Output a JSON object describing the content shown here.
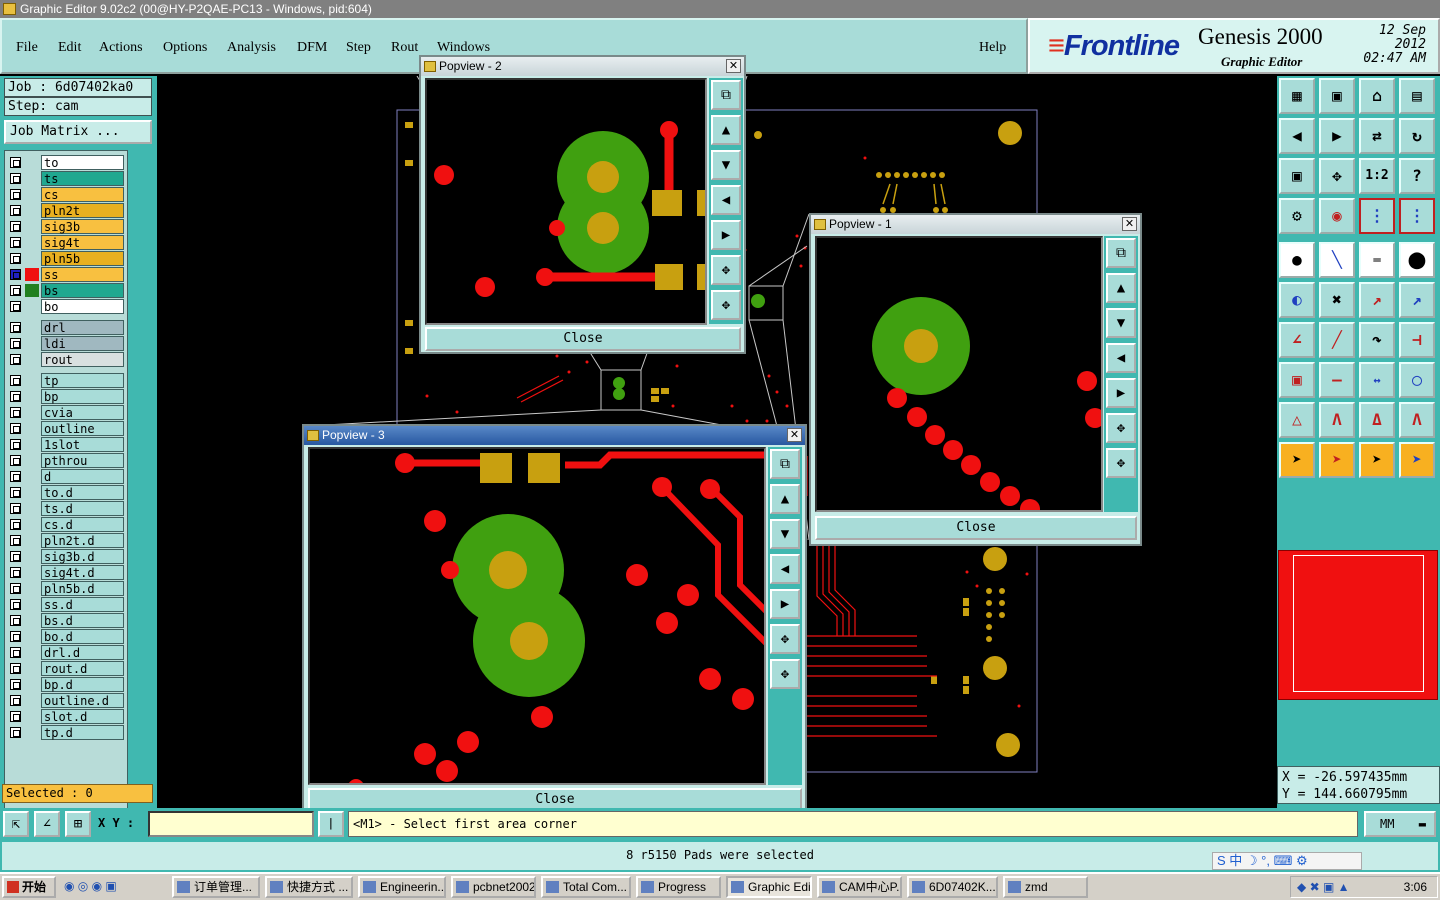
{
  "window": {
    "title": "Graphic Editor 9.02c2 (00@HY-P2QAE-PC13 - Windows, pid:604)"
  },
  "menu": {
    "file": "File",
    "edit": "Edit",
    "actions": "Actions",
    "options": "Options",
    "analysis": "Analysis",
    "dfm": "DFM",
    "step": "Step",
    "rout": "Rout",
    "windows": "Windows",
    "help": "Help"
  },
  "brand": {
    "logo": "Frontline",
    "product": "Genesis 2000",
    "subtitle": "Graphic Editor",
    "date_line1": "12 Sep 2012",
    "date_line2": "02:47 AM"
  },
  "job": {
    "job_label": "Job : 6d07402ka0",
    "step_label": "Step: cam",
    "matrix_button": "Job Matrix ..."
  },
  "layers": [
    {
      "name": "to",
      "color": "#ffffff",
      "flag": "✔"
    },
    {
      "name": "ts",
      "color": "#20a890",
      "flag": ""
    },
    {
      "name": "cs",
      "color": "#f8c040",
      "flag": ""
    },
    {
      "name": "pln2t",
      "color": "#e8b020",
      "flag": "✔"
    },
    {
      "name": "sig3b",
      "color": "#f8c040",
      "flag": ""
    },
    {
      "name": "sig4t",
      "color": "#f8c040",
      "flag": ""
    },
    {
      "name": "pln5b",
      "color": "#e8b020",
      "flag": "✔"
    },
    {
      "name": "ss",
      "color": "#f8c040",
      "flag": "▣"
    },
    {
      "name": "bs",
      "color": "#20a890",
      "flag": ""
    },
    {
      "name": "bo",
      "color": "#ffffff",
      "flag": "✔"
    },
    {
      "name": "drl",
      "color": "#a0b8c0",
      "flag": ""
    },
    {
      "name": "ldi",
      "color": "#a0b8c0",
      "flag": ""
    },
    {
      "name": "rout",
      "color": "#d8e0e0",
      "flag": ""
    },
    {
      "name": "tp",
      "color": "#a8dcd8",
      "flag": ""
    },
    {
      "name": "bp",
      "color": "#a8dcd8",
      "flag": ""
    },
    {
      "name": "cvia",
      "color": "#a8dcd8",
      "flag": ""
    },
    {
      "name": "outline",
      "color": "#a8dcd8",
      "flag": ""
    },
    {
      "name": "1slot",
      "color": "#a8dcd8",
      "flag": ""
    },
    {
      "name": "pthrou",
      "color": "#a8dcd8",
      "flag": ""
    },
    {
      "name": "d",
      "color": "#a8dcd8",
      "flag": ""
    },
    {
      "name": "to.d",
      "color": "#a8dcd8",
      "flag": "✔"
    },
    {
      "name": "ts.d",
      "color": "#a8dcd8",
      "flag": ""
    },
    {
      "name": "cs.d",
      "color": "#a8dcd8",
      "flag": ""
    },
    {
      "name": "pln2t.d",
      "color": "#a8dcd8",
      "flag": "✔"
    },
    {
      "name": "sig3b.d",
      "color": "#a8dcd8",
      "flag": ""
    },
    {
      "name": "sig4t.d",
      "color": "#a8dcd8",
      "flag": ""
    },
    {
      "name": "pln5b.d",
      "color": "#a8dcd8",
      "flag": "✔"
    },
    {
      "name": "ss.d",
      "color": "#a8dcd8",
      "flag": ""
    },
    {
      "name": "bs.d",
      "color": "#a8dcd8",
      "flag": ""
    },
    {
      "name": "bo.d",
      "color": "#a8dcd8",
      "flag": "✔"
    },
    {
      "name": "drl.d",
      "color": "#a8dcd8",
      "flag": ""
    },
    {
      "name": "rout.d",
      "color": "#a8dcd8",
      "flag": ""
    },
    {
      "name": "bp.d",
      "color": "#a8dcd8",
      "flag": ""
    },
    {
      "name": "outline.d",
      "color": "#a8dcd8",
      "flag": ""
    },
    {
      "name": "slot.d",
      "color": "#a8dcd8",
      "flag": ""
    },
    {
      "name": "tp.d",
      "color": "#a8dcd8",
      "flag": ""
    }
  ],
  "selected": "Selected : 0",
  "popups": {
    "p2": {
      "title": "Popview - 2",
      "close": "Close"
    },
    "p1": {
      "title": "Popview - 1",
      "close": "Close"
    },
    "p3": {
      "title": "Popview - 3",
      "close": "Close"
    }
  },
  "toolbar_icons": {
    "ratio_label": "1:2",
    "help_label": "?"
  },
  "coords": {
    "x": "X = -26.597435mm",
    "y": "Y = 144.660795mm"
  },
  "cmd": {
    "xy_label": "X Y :",
    "prompt": "<M1> - Select first area corner",
    "unit": "MM"
  },
  "status": {
    "message": "8 r5150 Pads were selected"
  },
  "ime": {
    "text": "S 中 ☽ °,"
  },
  "taskbar": {
    "start": "开始",
    "items": [
      "订单管理...",
      "快捷方式 ...",
      "Engineerin...",
      "pcbnet2002",
      "Total Com...",
      "Progress",
      "Graphic Edi...",
      "CAM中心P...",
      "6D07402K...",
      "zmd"
    ],
    "clock": "3:06"
  },
  "colors": {
    "pad_green": "#40a010",
    "pad_gold": "#c8a010",
    "trace_red": "#f01010",
    "panel_teal": "#40b8b0",
    "light_teal": "#a8dcd8"
  }
}
